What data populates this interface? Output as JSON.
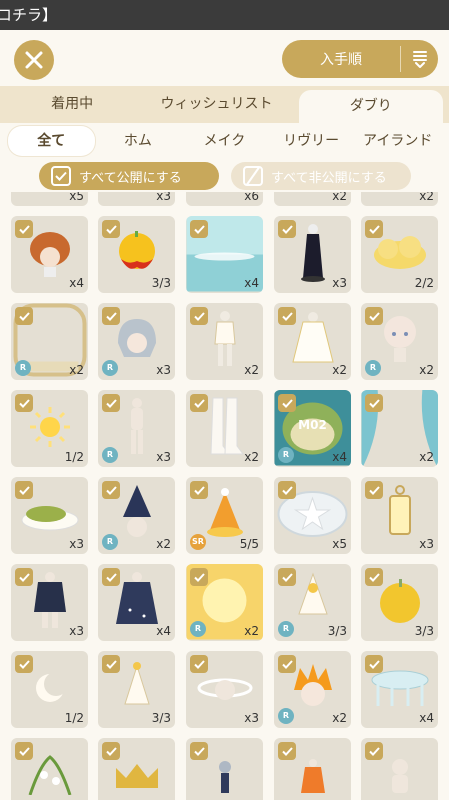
{
  "topbar": {
    "title": "コチラ】"
  },
  "header": {
    "sort_label": "入手順"
  },
  "tabs1": [
    "着用中",
    "ウィッシュリスト",
    "ダブり"
  ],
  "tabs2": [
    "全て",
    "ホム",
    "メイク",
    "リヴリー",
    "アイランド"
  ],
  "actions": {
    "publish_all": "すべて公開にする",
    "unpublish_all": "すべて非公開にする"
  },
  "colors": {
    "accent": "#c8a85b",
    "cell": "#e4dfd3",
    "rarity_r": "#6fb3c1",
    "rarity_sr": "#e6a23c"
  },
  "partial_row": [
    "x5",
    "x3",
    "x6",
    "x2",
    "x2"
  ],
  "rows": [
    [
      {
        "icon": "hair-orange-icon",
        "count": "x4"
      },
      {
        "icon": "flame-apple-icon",
        "count": "3/3"
      },
      {
        "icon": "sea-sky-icon",
        "count": "x4"
      },
      {
        "icon": "black-dress-icon",
        "count": "x3"
      },
      {
        "icon": "gold-cloud-icon",
        "count": "2/2"
      }
    ],
    [
      {
        "icon": "gold-frame-icon",
        "count": "x2",
        "rarity": "R"
      },
      {
        "icon": "silver-hair-icon",
        "count": "x3",
        "rarity": "R"
      },
      {
        "icon": "white-outfit-icon",
        "count": "x2"
      },
      {
        "icon": "white-cape-icon",
        "count": "x2"
      },
      {
        "icon": "face-icon",
        "count": "x2",
        "rarity": "R"
      }
    ],
    [
      {
        "icon": "sun-icon",
        "count": "1/2"
      },
      {
        "icon": "body-icon",
        "count": "x3",
        "rarity": "R"
      },
      {
        "icon": "white-boots-icon",
        "count": "x2"
      },
      {
        "icon": "m02-stage-icon",
        "count": "x4",
        "rarity": "R",
        "label": "M02"
      },
      {
        "icon": "curtain-icon",
        "count": "x2"
      }
    ],
    [
      {
        "icon": "food-plate-icon",
        "count": "x3"
      },
      {
        "icon": "wizard-hat-icon",
        "count": "x2",
        "rarity": "R"
      },
      {
        "icon": "party-hat-icon",
        "count": "5/5",
        "rarity": "SR"
      },
      {
        "icon": "star-plate-icon",
        "count": "x5"
      },
      {
        "icon": "lantern-icon",
        "count": "x3"
      }
    ],
    [
      {
        "icon": "dark-cape-icon",
        "count": "x3"
      },
      {
        "icon": "starry-cape-icon",
        "count": "x4"
      },
      {
        "icon": "sun-glow-icon",
        "count": "x2",
        "rarity": "R"
      },
      {
        "icon": "sun-hat-icon",
        "count": "3/3",
        "rarity": "R"
      },
      {
        "icon": "gold-apple-icon",
        "count": "3/3"
      }
    ],
    [
      {
        "icon": "moon-icon",
        "count": "1/2"
      },
      {
        "icon": "small-party-hat-icon",
        "count": "3/3"
      },
      {
        "icon": "halo-icon",
        "count": "x3"
      },
      {
        "icon": "fire-hair-icon",
        "count": "x2",
        "rarity": "R"
      },
      {
        "icon": "glass-table-icon",
        "count": "x4"
      }
    ],
    [
      {
        "icon": "lily-icon",
        "count": ""
      },
      {
        "icon": "crown-icon",
        "count": ""
      },
      {
        "icon": "ornament-icon",
        "count": ""
      },
      {
        "icon": "orange-dress-icon",
        "count": ""
      },
      {
        "icon": "bust-icon",
        "count": ""
      }
    ]
  ]
}
